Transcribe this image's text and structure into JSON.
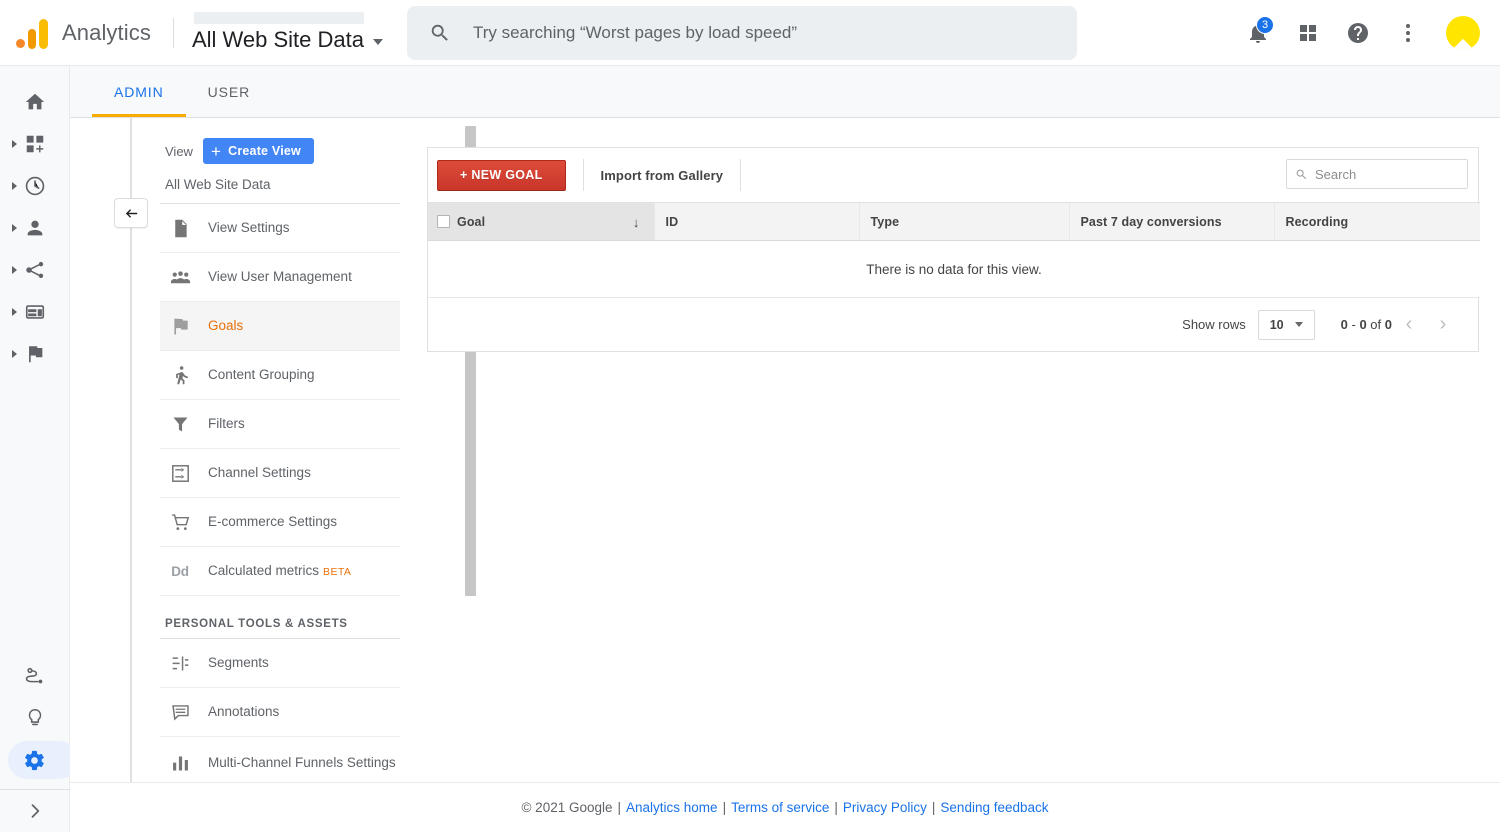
{
  "topbar": {
    "brand": "Analytics",
    "view_name": "All Web Site Data",
    "search_placeholder": "Try searching “Worst pages by load speed”",
    "notification_count": "3",
    "icons": [
      "bell-icon",
      "apps-grid-icon",
      "help-icon",
      "more-vert-icon",
      "avatar"
    ]
  },
  "rail": {
    "items": [
      {
        "name": "home",
        "expandable": false,
        "active": false
      },
      {
        "name": "customization",
        "expandable": true,
        "active": false
      },
      {
        "name": "realtime",
        "expandable": true,
        "active": false
      },
      {
        "name": "audience",
        "expandable": true,
        "active": false
      },
      {
        "name": "acquisition",
        "expandable": true,
        "active": false
      },
      {
        "name": "behavior",
        "expandable": true,
        "active": false
      },
      {
        "name": "conversions",
        "expandable": true,
        "active": false
      }
    ],
    "bottom": [
      {
        "name": "discover",
        "active": false
      },
      {
        "name": "insights",
        "active": false
      },
      {
        "name": "admin",
        "active": true
      }
    ],
    "expand_label": "›"
  },
  "tabs": [
    {
      "label": "ADMIN",
      "active": true
    },
    {
      "label": "USER",
      "active": false
    }
  ],
  "admin_panel": {
    "view_label": "View",
    "create_view_button": "Create View",
    "current_view": "All Web Site Data",
    "menu": [
      {
        "label": "View Settings",
        "icon": "document-icon",
        "selected": false
      },
      {
        "label": "View User Management",
        "icon": "people-icon",
        "selected": false
      },
      {
        "label": "Goals",
        "icon": "flag-icon",
        "selected": true
      },
      {
        "label": "Content Grouping",
        "icon": "walking-person-icon",
        "selected": false
      },
      {
        "label": "Filters",
        "icon": "funnel-icon",
        "selected": false
      },
      {
        "label": "Channel Settings",
        "icon": "channel-icon",
        "selected": false
      },
      {
        "label": "E-commerce Settings",
        "icon": "cart-icon",
        "selected": false
      },
      {
        "label": "Calculated metrics",
        "icon": "dd-icon",
        "badge": "BETA",
        "selected": false
      }
    ],
    "section_title": "PERSONAL TOOLS & ASSETS",
    "personal_menu": [
      {
        "label": "Segments",
        "icon": "segments-icon",
        "selected": false
      },
      {
        "label": "Annotations",
        "icon": "annotation-icon",
        "selected": false
      },
      {
        "label": "Multi-Channel Funnels Settings",
        "icon": "bar-chart-icon",
        "selected": false
      }
    ]
  },
  "goals": {
    "new_goal_button": "+ NEW GOAL",
    "import_link": "Import from Gallery",
    "search_placeholder": "Search",
    "columns": [
      "Goal",
      "ID",
      "Type",
      "Past 7 day conversions",
      "Recording"
    ],
    "sorted_column": "Goal",
    "sort_direction": "desc",
    "empty_message": "There is no data for this view.",
    "rows": [],
    "pagination": {
      "show_rows_label": "Show rows",
      "rows_per_page": "10",
      "range_from": "0",
      "range_to": "0",
      "total": "0",
      "range_text_of": "of",
      "prev_icon": "‹",
      "next_icon": "›"
    }
  },
  "footer": {
    "copyright": "© 2021 Google",
    "links": [
      "Analytics home",
      "Terms of service",
      "Privacy Policy",
      "Sending feedback"
    ],
    "separator": "|"
  },
  "colors": {
    "accent_blue": "#1a73e8",
    "tab_underline": "#f9ab00",
    "selected_orange": "#e8710a",
    "new_goal_red": "#dd4b39",
    "avatar_yellow": "#ffe500"
  }
}
